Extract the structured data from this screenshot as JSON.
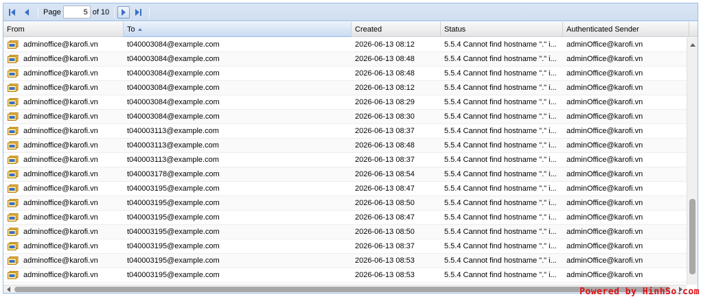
{
  "paging": {
    "page_label": "Page",
    "current_page": "5",
    "of_label": "of 10"
  },
  "columns": {
    "from": "From",
    "to": "To",
    "created": "Created",
    "status": "Status",
    "auth_sender": "Authenticated Sender"
  },
  "sort": {
    "column": "To",
    "direction": "ascending"
  },
  "rows": [
    {
      "from": "adminoffice@karofi.vn",
      "to": "t040003084@example.com",
      "created": "2026-06-13 08:12",
      "status": "5.5.4 Cannot find hostname \".\" i...",
      "auth_sender": "adminOffice@karofi.vn"
    },
    {
      "from": "adminoffice@karofi.vn",
      "to": "t040003084@example.com",
      "created": "2026-06-13 08:48",
      "status": "5.5.4 Cannot find hostname \".\" i...",
      "auth_sender": "adminOffice@karofi.vn"
    },
    {
      "from": "adminoffice@karofi.vn",
      "to": "t040003084@example.com",
      "created": "2026-06-13 08:48",
      "status": "5.5.4 Cannot find hostname \".\" i...",
      "auth_sender": "adminOffice@karofi.vn"
    },
    {
      "from": "adminoffice@karofi.vn",
      "to": "t040003084@example.com",
      "created": "2026-06-13 08:12",
      "status": "5.5.4 Cannot find hostname \".\" i...",
      "auth_sender": "adminOffice@karofi.vn"
    },
    {
      "from": "adminoffice@karofi.vn",
      "to": "t040003084@example.com",
      "created": "2026-06-13 08:29",
      "status": "5.5.4 Cannot find hostname \".\" i...",
      "auth_sender": "adminOffice@karofi.vn"
    },
    {
      "from": "adminoffice@karofi.vn",
      "to": "t040003084@example.com",
      "created": "2026-06-13 08:30",
      "status": "5.5.4 Cannot find hostname \".\" i...",
      "auth_sender": "adminOffice@karofi.vn"
    },
    {
      "from": "adminoffice@karofi.vn",
      "to": "t040003113@example.com",
      "created": "2026-06-13 08:37",
      "status": "5.5.4 Cannot find hostname \".\" i...",
      "auth_sender": "adminOffice@karofi.vn"
    },
    {
      "from": "adminoffice@karofi.vn",
      "to": "t040003113@example.com",
      "created": "2026-06-13 08:48",
      "status": "5.5.4 Cannot find hostname \".\" i...",
      "auth_sender": "adminOffice@karofi.vn"
    },
    {
      "from": "adminoffice@karofi.vn",
      "to": "t040003113@example.com",
      "created": "2026-06-13 08:37",
      "status": "5.5.4 Cannot find hostname \".\" i...",
      "auth_sender": "adminOffice@karofi.vn"
    },
    {
      "from": "adminoffice@karofi.vn",
      "to": "t040003178@example.com",
      "created": "2026-06-13 08:54",
      "status": "5.5.4 Cannot find hostname \".\" i...",
      "auth_sender": "adminOffice@karofi.vn"
    },
    {
      "from": "adminoffice@karofi.vn",
      "to": "t040003195@example.com",
      "created": "2026-06-13 08:47",
      "status": "5.5.4 Cannot find hostname \".\" i...",
      "auth_sender": "adminOffice@karofi.vn"
    },
    {
      "from": "adminoffice@karofi.vn",
      "to": "t040003195@example.com",
      "created": "2026-06-13 08:50",
      "status": "5.5.4 Cannot find hostname \".\" i...",
      "auth_sender": "adminOffice@karofi.vn"
    },
    {
      "from": "adminoffice@karofi.vn",
      "to": "t040003195@example.com",
      "created": "2026-06-13 08:47",
      "status": "5.5.4 Cannot find hostname \".\" i...",
      "auth_sender": "adminOffice@karofi.vn"
    },
    {
      "from": "adminoffice@karofi.vn",
      "to": "t040003195@example.com",
      "created": "2026-06-13 08:50",
      "status": "5.5.4 Cannot find hostname \".\" i...",
      "auth_sender": "adminOffice@karofi.vn"
    },
    {
      "from": "adminoffice@karofi.vn",
      "to": "t040003195@example.com",
      "created": "2026-06-13 08:37",
      "status": "5.5.4 Cannot find hostname \".\" i...",
      "auth_sender": "adminOffice@karofi.vn"
    },
    {
      "from": "adminoffice@karofi.vn",
      "to": "t040003195@example.com",
      "created": "2026-06-13 08:53",
      "status": "5.5.4 Cannot find hostname \".\" i...",
      "auth_sender": "adminOffice@karofi.vn"
    },
    {
      "from": "adminoffice@karofi.vn",
      "to": "t040003195@example.com",
      "created": "2026-06-13 08:53",
      "status": "5.5.4 Cannot find hostname \".\" i...",
      "auth_sender": "adminOffice@karofi.vn"
    }
  ],
  "watermark": "Powered by HinhSo.com",
  "colors": {
    "accent": "#99bbe8",
    "icon_blue": "#3a6fc4",
    "watermark": "#e01010"
  }
}
